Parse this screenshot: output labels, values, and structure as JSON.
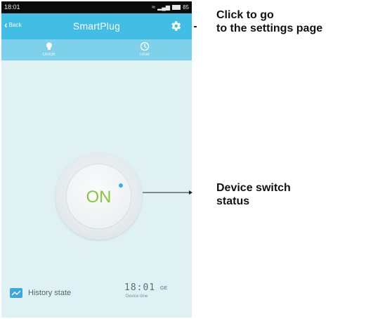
{
  "status_bar": {
    "time": "18:01",
    "battery": "85",
    "icons": [
      "wifi-icon",
      "signal-icon",
      "battery-icon"
    ]
  },
  "header": {
    "back_label": "Back",
    "title": "SmartPlug",
    "settings_icon": "gear-icon"
  },
  "tabs": [
    {
      "label": "On/Off",
      "icon": "bulb-icon"
    },
    {
      "label": "Timer",
      "icon": "clock-icon"
    }
  ],
  "device_switch": {
    "state": "ON",
    "state_color": "#8bc53f",
    "indicator_color": "#2db7e8"
  },
  "footer": {
    "history_label": "History state",
    "history_icon": "chart-icon",
    "device_time": "18:01",
    "timezone": "GE",
    "device_time_label": "Device time"
  },
  "annotations": {
    "settings": [
      "Click to go",
      "to the settings page"
    ],
    "switch": [
      "Device switch",
      "status"
    ]
  },
  "colors": {
    "header": "#42bde3",
    "tab_bar": "#7fd0ea",
    "background": "#e0f1f3"
  }
}
